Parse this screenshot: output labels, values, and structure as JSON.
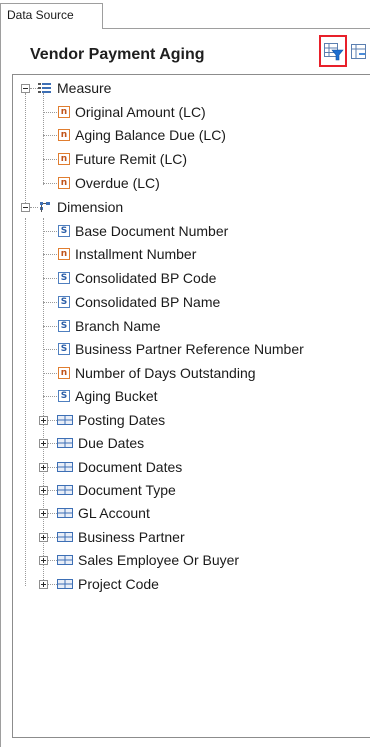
{
  "tab": {
    "label": "Data Source"
  },
  "panel": {
    "title": "Vendor Payment Aging"
  },
  "tree": {
    "measure": {
      "label": "Measure",
      "items": [
        {
          "label": "Original Amount (LC)",
          "type": "n"
        },
        {
          "label": "Aging Balance Due (LC)",
          "type": "n"
        },
        {
          "label": "Future Remit (LC)",
          "type": "n"
        },
        {
          "label": "Overdue (LC)",
          "type": "n"
        }
      ]
    },
    "dimension": {
      "label": "Dimension",
      "items": [
        {
          "label": "Base Document Number",
          "type": "s"
        },
        {
          "label": "Installment Number",
          "type": "n"
        },
        {
          "label": "Consolidated BP Code",
          "type": "s"
        },
        {
          "label": "Consolidated BP Name",
          "type": "s"
        },
        {
          "label": "Branch Name",
          "type": "s"
        },
        {
          "label": "Business Partner Reference Number",
          "type": "s"
        },
        {
          "label": "Number of Days Outstanding",
          "type": "n"
        },
        {
          "label": "Aging Bucket",
          "type": "s"
        }
      ],
      "groups": [
        {
          "label": "Posting Dates"
        },
        {
          "label": "Due Dates"
        },
        {
          "label": "Document Dates"
        },
        {
          "label": "Document Type"
        },
        {
          "label": "GL Account"
        },
        {
          "label": "Business Partner"
        },
        {
          "label": "Sales Employee Or Buyer"
        },
        {
          "label": "Project Code"
        }
      ]
    }
  },
  "icons": {
    "numeric_glyph": "n",
    "string_glyph": "S"
  },
  "colors": {
    "highlight_border": "#e8202a",
    "numeric_icon": "#e07d2f",
    "string_icon": "#4f7fbf",
    "group_icon": "#3d6fb5"
  }
}
